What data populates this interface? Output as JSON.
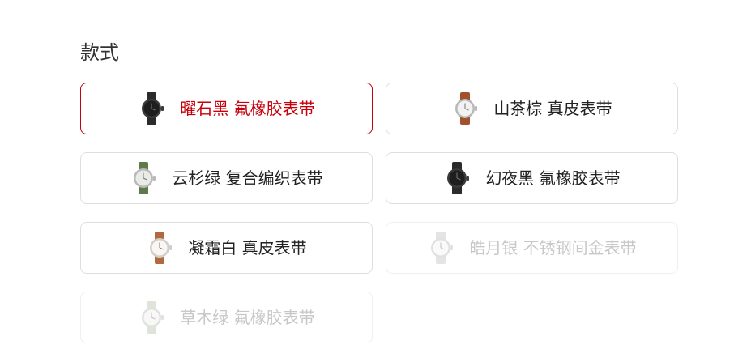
{
  "section": {
    "title": "款式"
  },
  "options": [
    {
      "label": "曜石黑 氟橡胶表带",
      "state": "selected",
      "icon": "black-rubber-watch-icon",
      "band_color": "#2b2b2b",
      "case_color": "#3a3a3a",
      "dial_color": "#1e1e1e"
    },
    {
      "label": "山茶棕 真皮表带",
      "state": "available",
      "icon": "brown-leather-watch-icon",
      "band_color": "#a0522d",
      "case_color": "#b9b9b9",
      "dial_color": "#f2f2f2"
    },
    {
      "label": "云杉绿 复合编织表带",
      "state": "available",
      "icon": "green-woven-watch-icon",
      "band_color": "#5e7a4b",
      "case_color": "#b9b9b9",
      "dial_color": "#e9ece6"
    },
    {
      "label": "幻夜黑 氟橡胶表带",
      "state": "available",
      "icon": "black-rubber-watch-icon",
      "band_color": "#2b2b2b",
      "case_color": "#3a3a3a",
      "dial_color": "#1e1e1e"
    },
    {
      "label": "凝霜白 真皮表带",
      "state": "available",
      "icon": "white-leather-watch-icon",
      "band_color": "#b06a3d",
      "case_color": "#cfcfcf",
      "dial_color": "#fbf6f1"
    },
    {
      "label": "皓月银 不锈钢间金表带",
      "state": "disabled",
      "icon": "silver-steel-watch-icon",
      "band_color": "#c4c4c4",
      "case_color": "#bdbdbd",
      "dial_color": "#f4f4f4"
    },
    {
      "label": "草木绿 氟橡胶表带",
      "state": "disabled",
      "icon": "sage-rubber-watch-icon",
      "band_color": "#b9c4b0",
      "case_color": "#bdbdbd",
      "dial_color": "#f1f3ef"
    }
  ]
}
